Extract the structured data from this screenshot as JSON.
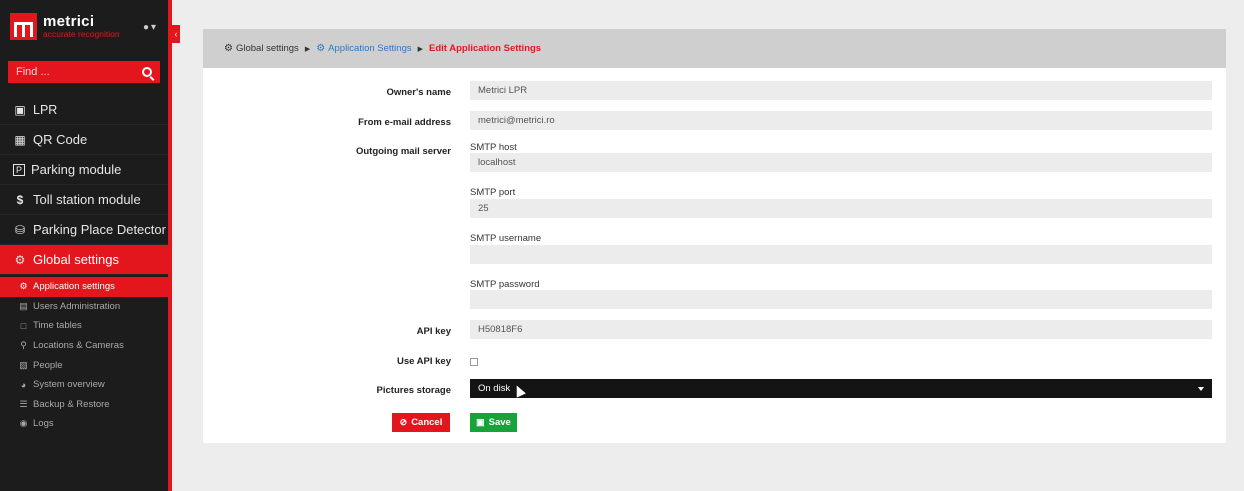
{
  "brand": {
    "name": "metrici",
    "tagline": "accurate recognition"
  },
  "user_menu": {
    "icon": "user-icon",
    "caret": "▾"
  },
  "search": {
    "placeholder": "Find ...",
    "icon": "search-icon"
  },
  "nav": [
    {
      "label": "LPR",
      "icon": "camera-icon"
    },
    {
      "label": "QR Code",
      "icon": "qrcode-icon"
    },
    {
      "label": "Parking module",
      "icon": "parking-icon"
    },
    {
      "label": "Toll station module",
      "icon": "dollar-icon"
    },
    {
      "label": "Parking Place Detector",
      "icon": "car-icon"
    },
    {
      "label": "Global settings",
      "icon": "gears-icon",
      "active": true
    }
  ],
  "subnav": [
    {
      "label": "Application settings",
      "icon": "gear-icon",
      "active": true
    },
    {
      "label": "Users Administration",
      "icon": "users-icon"
    },
    {
      "label": "Time tables",
      "icon": "calendar-icon"
    },
    {
      "label": "Locations & Cameras",
      "icon": "location-pin-icon"
    },
    {
      "label": "People",
      "icon": "id-card-icon"
    },
    {
      "label": "System overview",
      "icon": "dashboard-icon"
    },
    {
      "label": "Backup & Restore",
      "icon": "database-icon"
    },
    {
      "label": "Logs",
      "icon": "eye-icon"
    }
  ],
  "breadcrumb": {
    "root": "Global settings",
    "middle": "Application Settings",
    "current": "Edit Application Settings"
  },
  "form": {
    "owner_label": "Owner's name",
    "owner_value": "Metrici LPR",
    "from_email_label": "From e-mail address",
    "from_email_value": "metrici@metrici.ro",
    "mail_server_label": "Outgoing mail server",
    "smtp_host_label": "SMTP host",
    "smtp_host_value": "localhost",
    "smtp_port_label": "SMTP port",
    "smtp_port_value": "25",
    "smtp_username_label": "SMTP username",
    "smtp_username_value": "",
    "smtp_password_label": "SMTP password",
    "smtp_password_value": "",
    "api_key_label": "API key",
    "api_key_value": "H50818F6",
    "use_api_key_label": "Use API key",
    "use_api_key_checked": false,
    "storage_label": "Pictures storage",
    "storage_value": "On disk"
  },
  "actions": {
    "cancel": "Cancel",
    "save": "Save"
  },
  "colors": {
    "accent": "#e4161d",
    "sidebar": "#1c1c1c",
    "link": "#2f78c4",
    "save": "#18a23a"
  }
}
